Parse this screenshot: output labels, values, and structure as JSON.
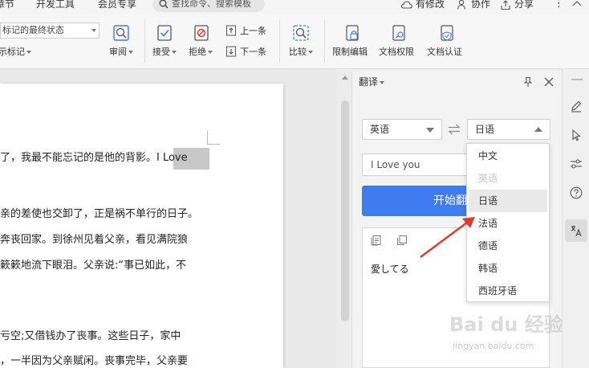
{
  "menu": {
    "tabs": [
      "章节",
      "开发工具",
      "会员专享"
    ],
    "search_placeholder": "查找命令、搜索模板",
    "right_items": [
      "有修改",
      "协作",
      "分享"
    ]
  },
  "ribbon": {
    "markup_select_value": "标记的最终状态",
    "show_markup_label": "示标记",
    "review_label": "审阅",
    "accept_label": "接受",
    "reject_label": "拒绝",
    "prev_label": "上一条",
    "next_label": "下一条",
    "compare_label": "比较",
    "restrict_edit_label": "限制编辑",
    "doc_permission_label": "文档权限",
    "doc_cert_label": "文档认证"
  },
  "document": {
    "lines": [
      "了，我最不能忘记的是他的背影。I Love",
      "亲的差使也交卸了，正是祸不单行的日子。",
      "奔丧回家。到徐州见着父亲，看见满院狼",
      "簌簌地流下眼泪。父亲说:“事已如此，不",
      "亏空;又借钱办了丧事。这些日子，家中",
      "，一半因为父亲赋闲。丧事完毕，父亲要"
    ]
  },
  "translate_pane": {
    "title": "翻译",
    "source_lang": "英语",
    "target_lang": "日语",
    "source_text": "I Love you",
    "button_label": "开始翻译",
    "result_text": "愛してる"
  },
  "dropdown": {
    "options": [
      {
        "label": "中文",
        "state": "normal"
      },
      {
        "label": "英语",
        "state": "disabled"
      },
      {
        "label": "日语",
        "state": "selected"
      },
      {
        "label": "法语",
        "state": "normal"
      },
      {
        "label": "德语",
        "state": "normal"
      },
      {
        "label": "韩语",
        "state": "normal"
      },
      {
        "label": "西班牙语",
        "state": "normal"
      }
    ]
  },
  "watermark": {
    "main": "Bai du 经验",
    "sub": "jingyan.baidu.com"
  },
  "colors": {
    "accent": "#3e7cf0",
    "annotation": "#e03a2f"
  }
}
